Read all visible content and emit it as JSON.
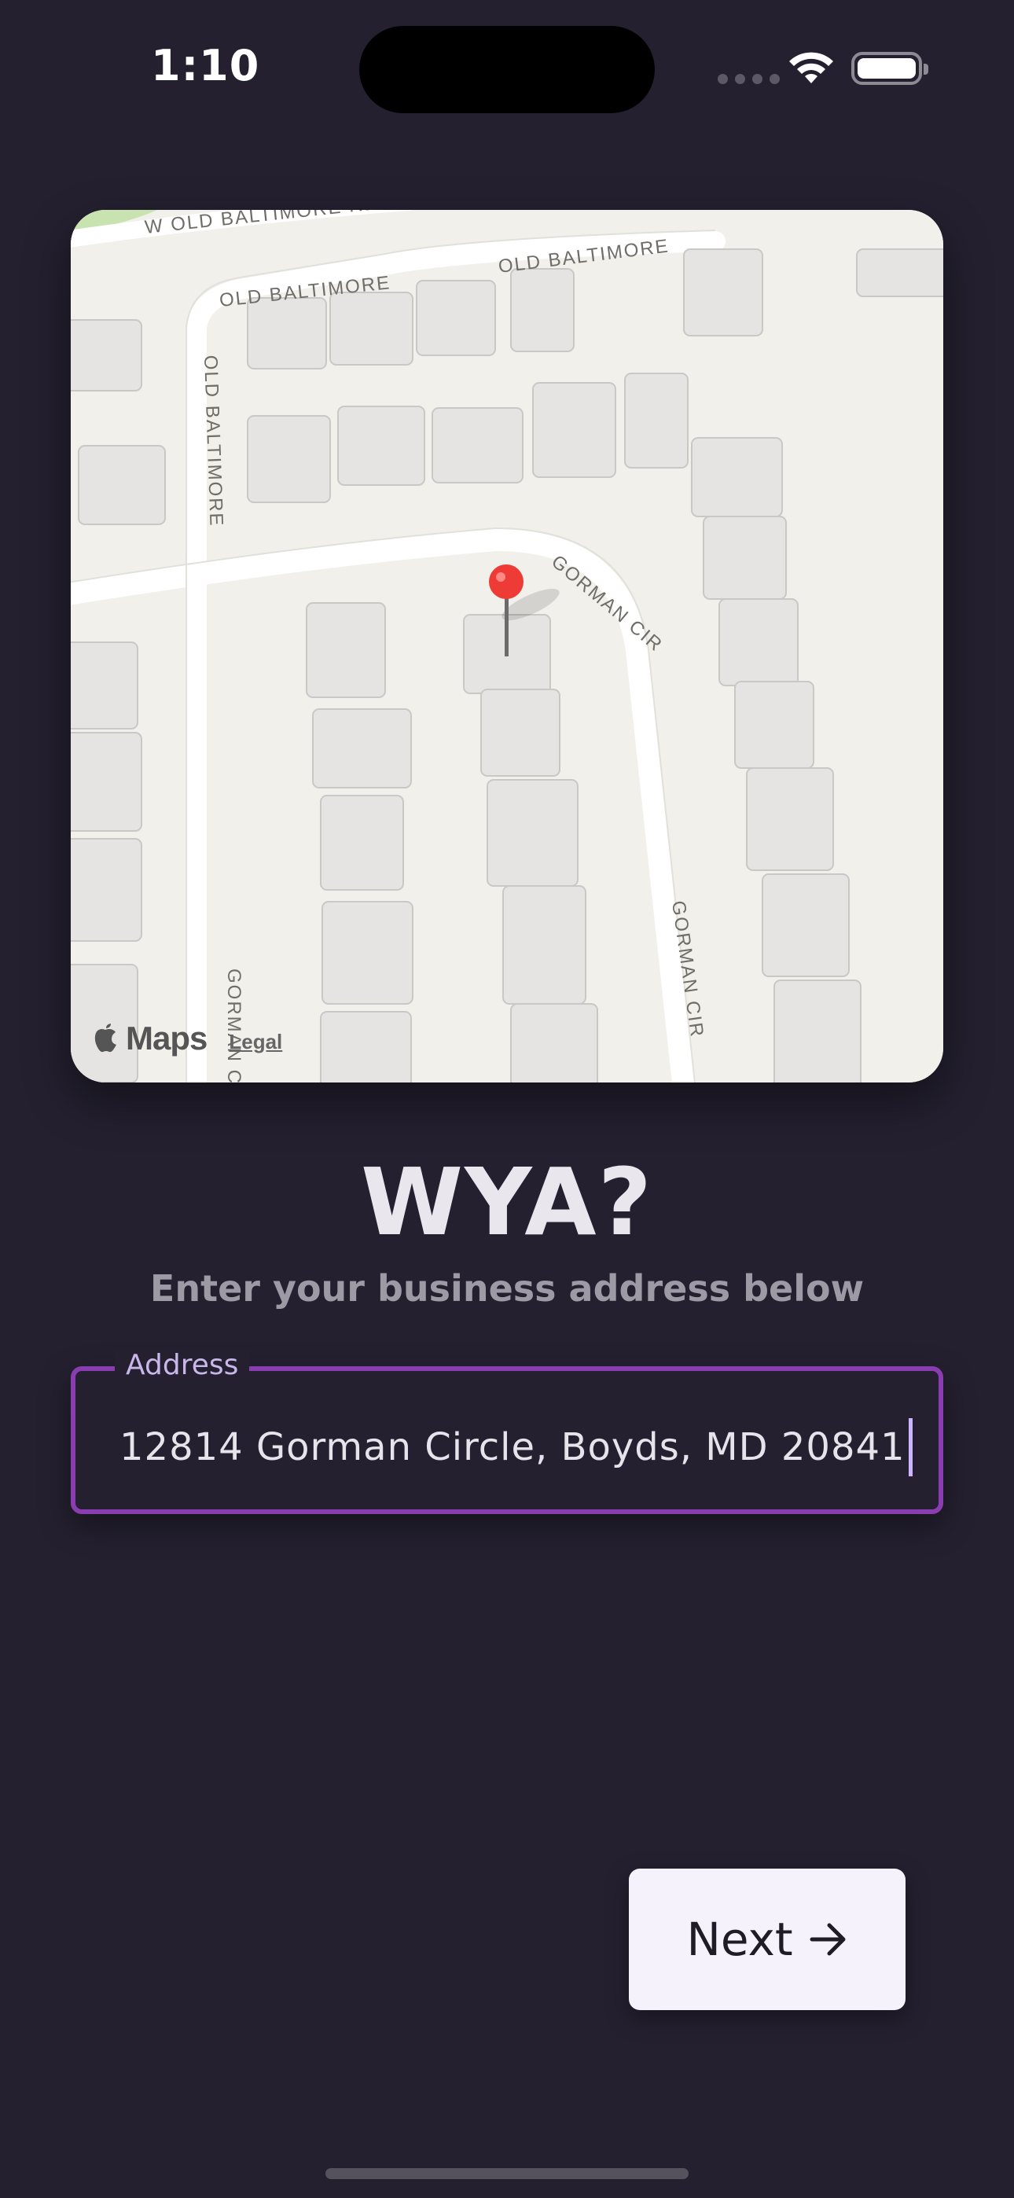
{
  "status": {
    "time": "1:10",
    "icons": [
      "cellular-dots-icon",
      "wifi-icon",
      "battery-icon"
    ]
  },
  "map": {
    "street_labels": [
      "W OLD BALTIMORE RD",
      "OLD BALTIMORE",
      "OLD BALTIMORE",
      "OLD BALTIMORE",
      "GORMAN CIR",
      "GORMAN CIR",
      "GORMAN C"
    ],
    "attribution": "Maps",
    "legal": "Legal",
    "pin_color": "#ef3b36"
  },
  "content": {
    "headline": "WYA?",
    "subtitle": "Enter your business address below"
  },
  "address": {
    "label": "Address",
    "value": "12814 Gorman Circle, Boyds, MD 20841",
    "border_color": "#8a3db0"
  },
  "actions": {
    "next_label": "Next"
  },
  "colors": {
    "background": "#242030",
    "accent": "#8a3db0",
    "button_bg": "#f5f2fb"
  }
}
